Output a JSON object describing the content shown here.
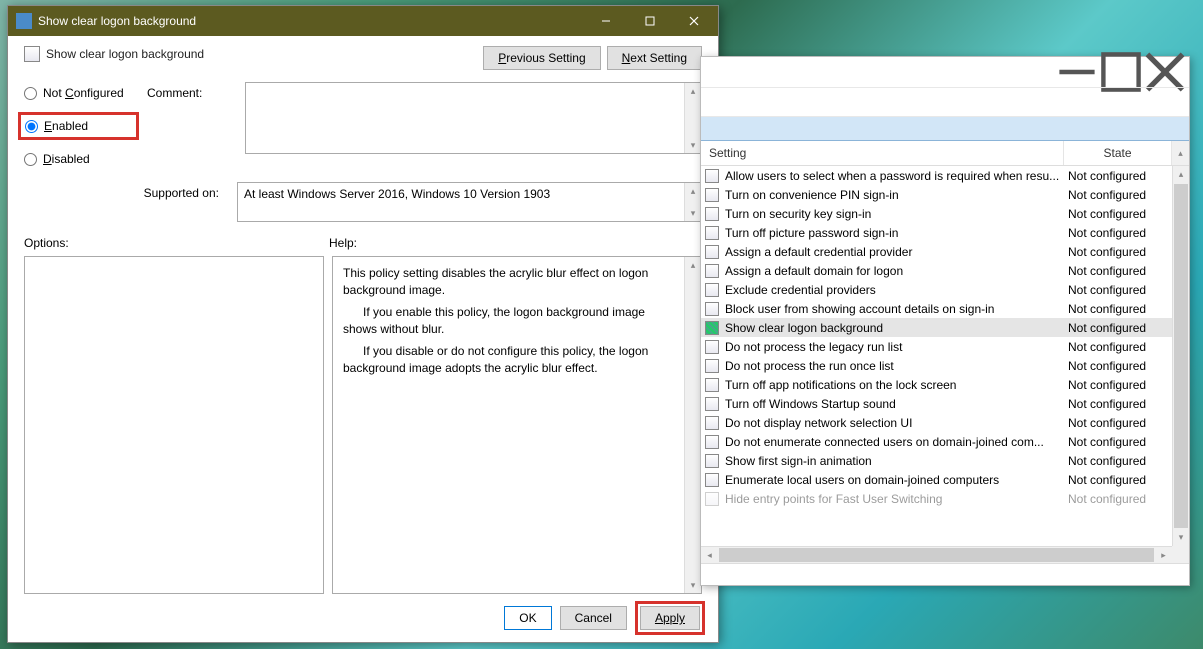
{
  "dialog": {
    "title": "Show clear logon background",
    "setting_name": "Show clear logon background",
    "prev_button": "Previous Setting",
    "next_button": "Next Setting",
    "radio_not_configured": "Not Configured",
    "radio_enabled": "Enabled",
    "radio_disabled": "Disabled",
    "comment_label": "Comment:",
    "comment_value": "",
    "supported_label": "Supported on:",
    "supported_value": "At least Windows Server 2016, Windows 10 Version 1903",
    "options_label": "Options:",
    "help_label": "Help:",
    "help_text": {
      "p1": "This policy setting disables the acrylic blur effect on logon background image.",
      "p2": "If you enable this policy, the logon background image shows without blur.",
      "p3": "If you disable or do not configure this policy, the logon background image adopts the acrylic blur effect."
    },
    "ok": "OK",
    "cancel": "Cancel",
    "apply": "Apply"
  },
  "gpe": {
    "col_setting": "Setting",
    "col_state": "State",
    "rows": [
      {
        "name": "Allow users to select when a password is required when resu...",
        "state": "Not configured"
      },
      {
        "name": "Turn on convenience PIN sign-in",
        "state": "Not configured"
      },
      {
        "name": "Turn on security key sign-in",
        "state": "Not configured"
      },
      {
        "name": "Turn off picture password sign-in",
        "state": "Not configured"
      },
      {
        "name": "Assign a default credential provider",
        "state": "Not configured"
      },
      {
        "name": "Assign a default domain for logon",
        "state": "Not configured"
      },
      {
        "name": "Exclude credential providers",
        "state": "Not configured"
      },
      {
        "name": "Block user from showing account details on sign-in",
        "state": "Not configured"
      },
      {
        "name": "Show clear logon background",
        "state": "Not configured",
        "selected": true
      },
      {
        "name": "Do not process the legacy run list",
        "state": "Not configured"
      },
      {
        "name": "Do not process the run once list",
        "state": "Not configured"
      },
      {
        "name": "Turn off app notifications on the lock screen",
        "state": "Not configured"
      },
      {
        "name": "Turn off Windows Startup sound",
        "state": "Not configured"
      },
      {
        "name": "Do not display network selection UI",
        "state": "Not configured"
      },
      {
        "name": "Do not enumerate connected users on domain-joined com...",
        "state": "Not configured"
      },
      {
        "name": "Show first sign-in animation",
        "state": "Not configured"
      },
      {
        "name": "Enumerate local users on domain-joined computers",
        "state": "Not configured"
      },
      {
        "name": "Hide entry points for Fast User Switching",
        "state": "Not configured",
        "faded": true
      }
    ]
  }
}
